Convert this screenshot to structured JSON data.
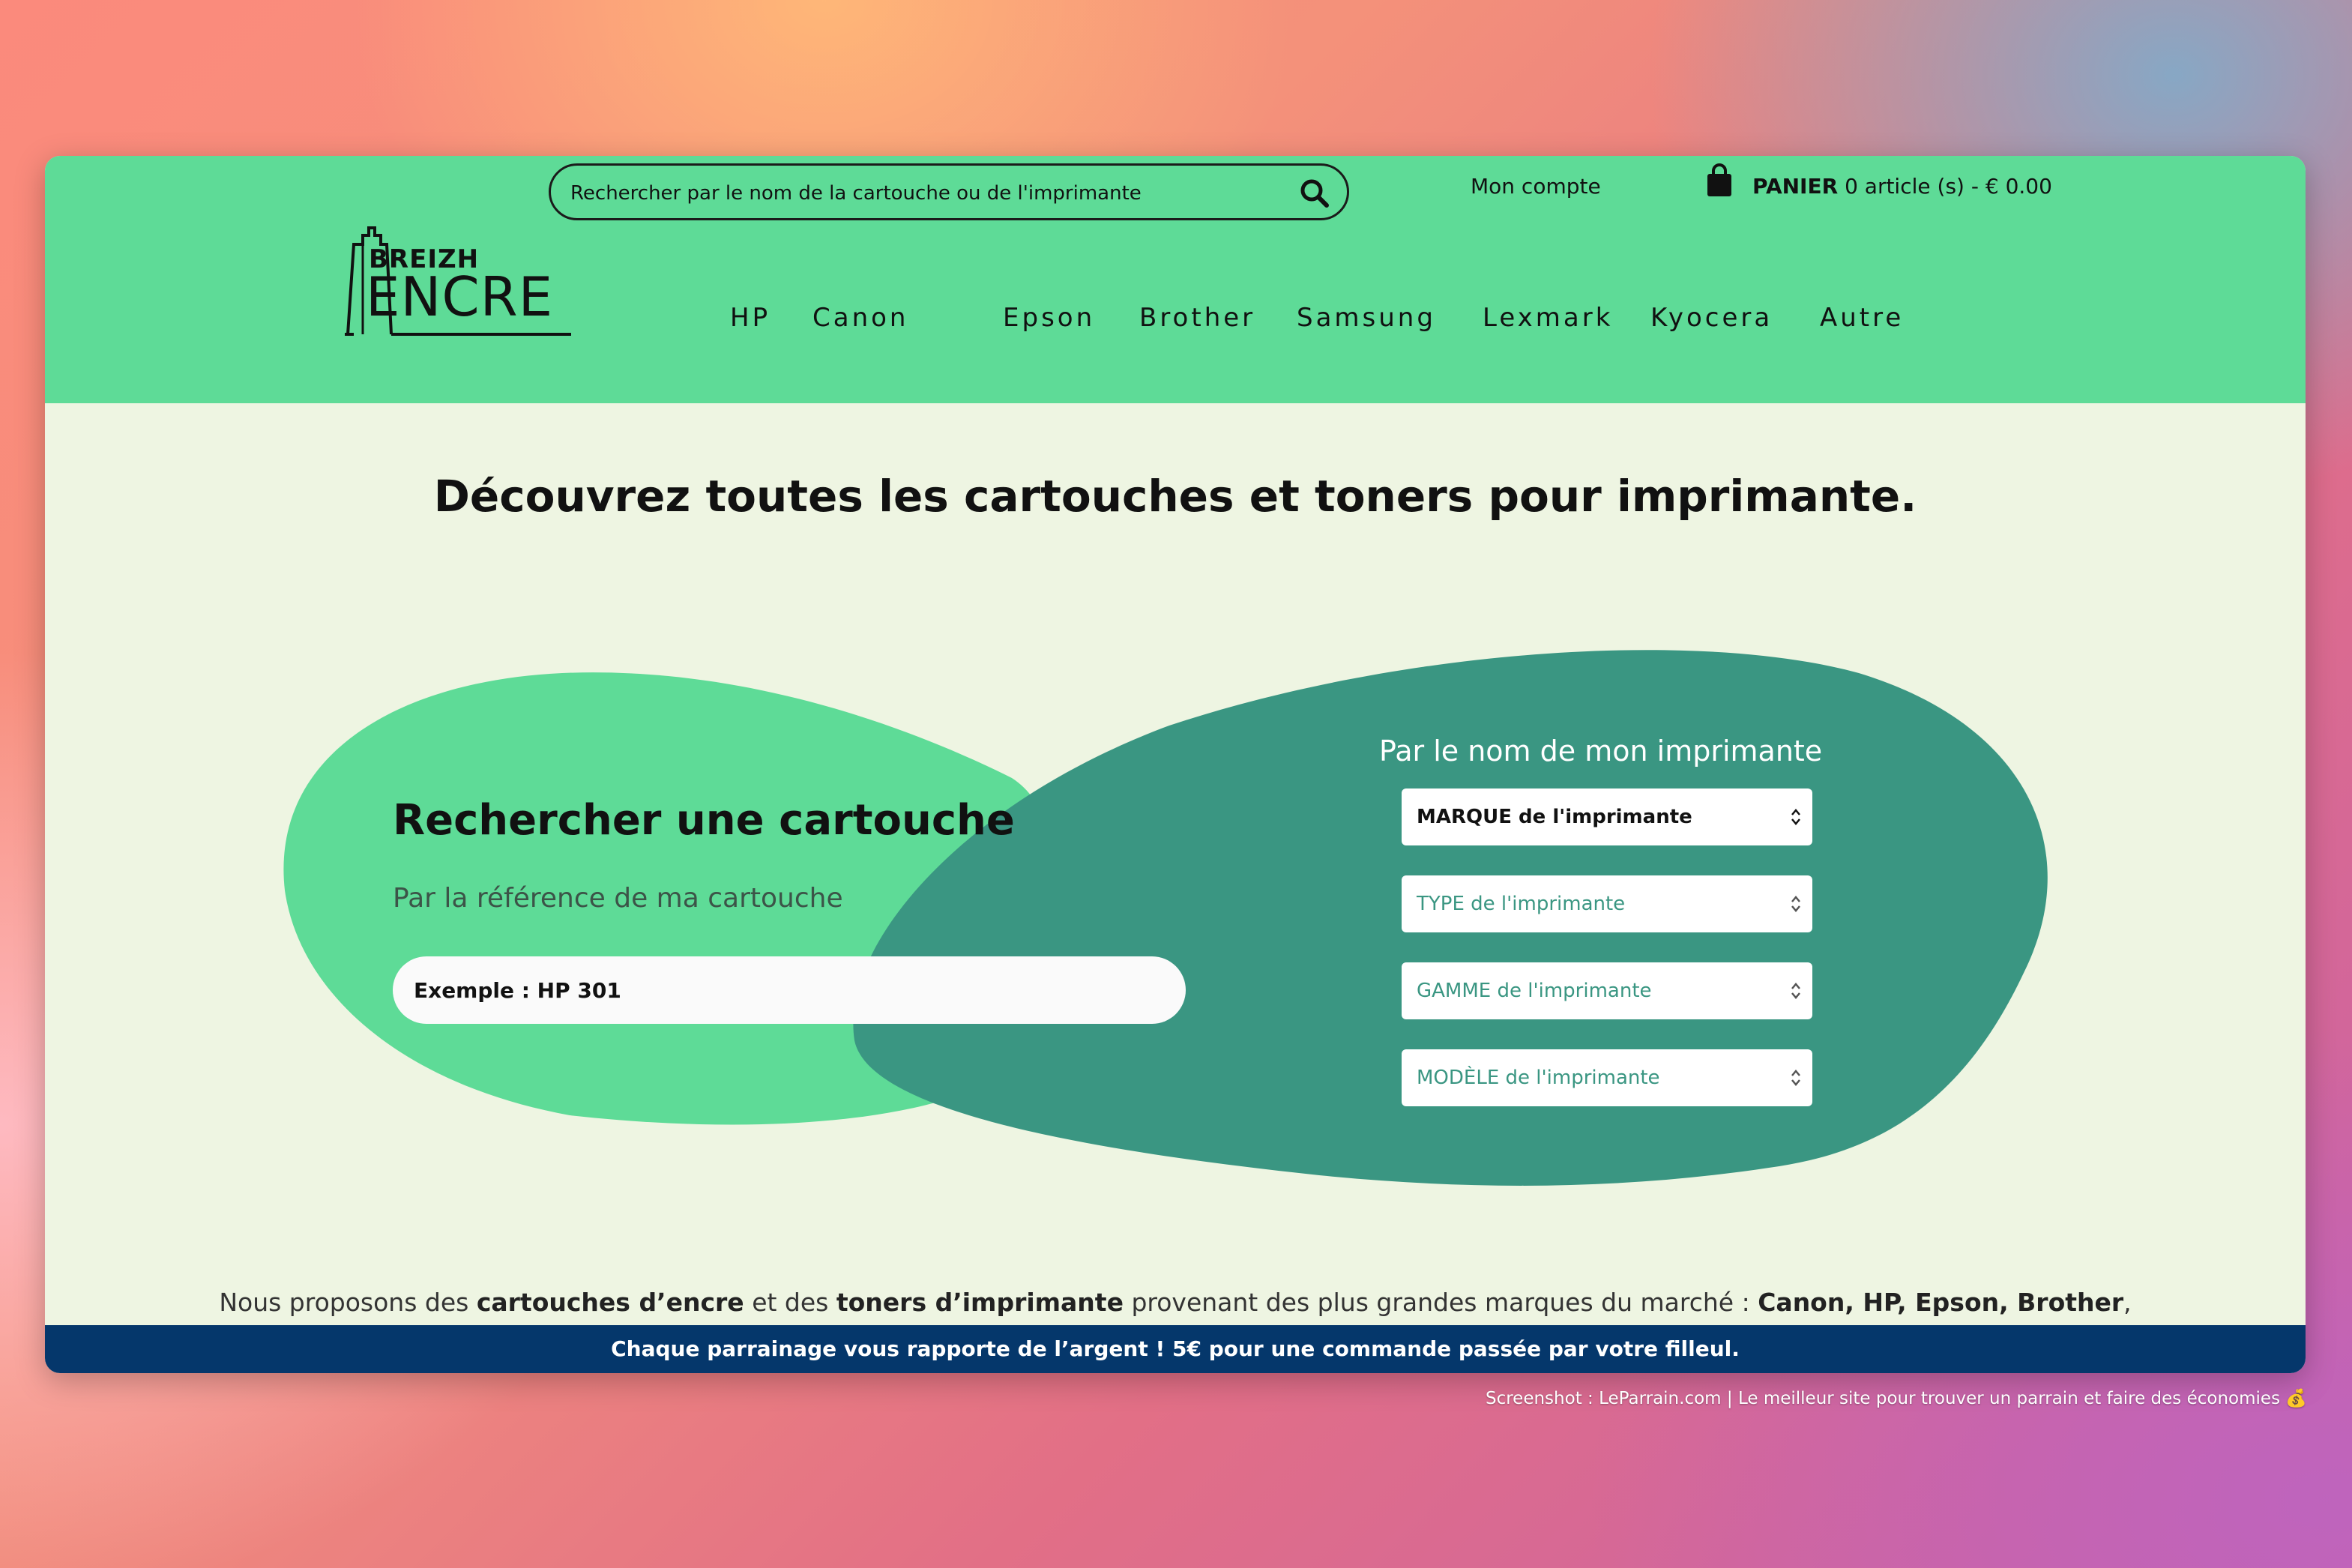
{
  "header": {
    "search_placeholder": "Rechercher par le nom de la cartouche ou de l'imprimante",
    "account_label": "Mon compte",
    "cart_label": "PANIER",
    "cart_summary": " 0 article (s) - € 0.00",
    "logo_line1": "BREIZH",
    "logo_line2": "ENCRE",
    "nav": [
      "HP",
      "Canon",
      "Epson",
      "Brother",
      "Samsung",
      "Lexmark",
      "Kyocera",
      "Autre"
    ],
    "icons": {
      "search": "search-icon",
      "cart": "shopping-bag-icon"
    }
  },
  "main": {
    "headline": "Découvrez toutes les cartouches et toners pour imprimante.",
    "search_title": "Rechercher une cartouche",
    "ref_label": "Par la référence de ma cartouche",
    "ref_placeholder": "Exemple : HP 301",
    "printer_label": "Par le nom de mon imprimante",
    "selects": [
      "MARQUE de l'imprimante",
      "TYPE de l'imprimante",
      "GAMME de l'imprimante",
      "MODÈLE de l'imprimante"
    ]
  },
  "bottom": {
    "t1": "Nous proposons des ",
    "b1": "cartouches d’encre",
    "t2": " et des ",
    "b2": "toners d’imprimante",
    "t3": " provenant des plus grandes marques du marché : ",
    "b3": "Canon, HP, Epson, Brother",
    "t4": ","
  },
  "banner": "Chaque parrainage vous rapporte de l’argent ! 5€ pour une commande passée par votre filleul.",
  "credit": "Screenshot : LeParrain.com | Le meilleur site pour trouver un parrain et faire des économies 💰",
  "colors": {
    "header_green": "#5edb97",
    "page_bg": "#eef5e2",
    "blob_light": "#5edb97",
    "blob_dark": "#3a9682",
    "banner": "#05376b"
  }
}
